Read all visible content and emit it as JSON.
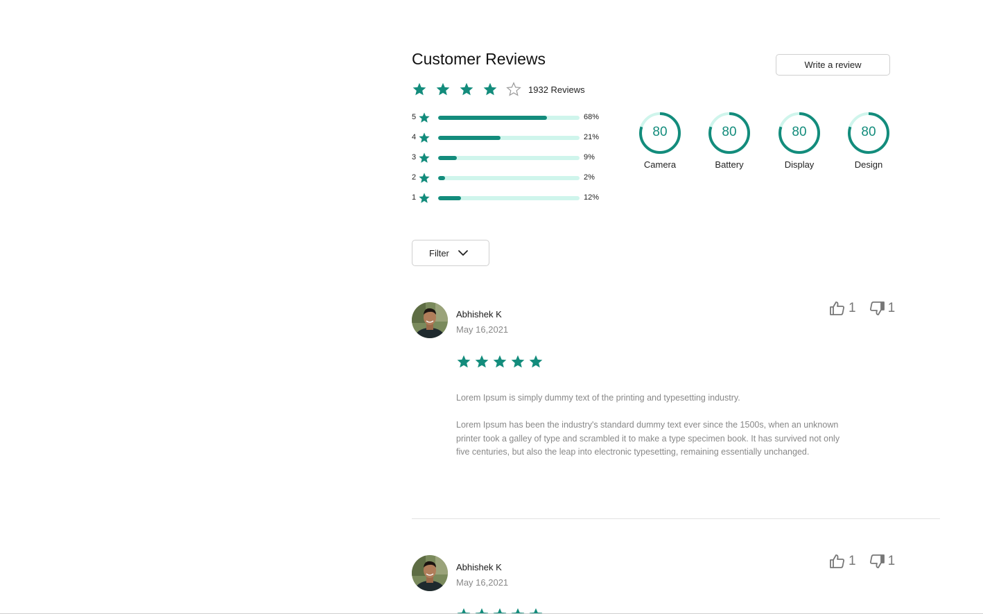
{
  "header": {
    "title": "Customer Reviews",
    "write_review_label": "Write a review"
  },
  "summary": {
    "rating_stars": 4,
    "max_stars": 5,
    "review_count_text": "1932 Reviews"
  },
  "distribution": [
    {
      "stars": "5",
      "percent_label": "68%",
      "fill_fraction": 0.77
    },
    {
      "stars": "4",
      "percent_label": "21%",
      "fill_fraction": 0.44
    },
    {
      "stars": "3",
      "percent_label": "9%",
      "fill_fraction": 0.13
    },
    {
      "stars": "2",
      "percent_label": "2%",
      "fill_fraction": 0.05
    },
    {
      "stars": "1",
      "percent_label": "12%",
      "fill_fraction": 0.16
    }
  ],
  "aspects": [
    {
      "label": "Camera",
      "score": "80",
      "fraction": 0.8
    },
    {
      "label": "Battery",
      "score": "80",
      "fraction": 0.8
    },
    {
      "label": "Display",
      "score": "80",
      "fraction": 0.8
    },
    {
      "label": "Design",
      "score": "80",
      "fraction": 0.8
    }
  ],
  "filter": {
    "label": "Filter"
  },
  "reviews": [
    {
      "name": "Abhishek K",
      "date": "May 16,2021",
      "stars": 5,
      "likes": "1",
      "dislikes": "1",
      "text1": "Lorem Ipsum is simply dummy text of the printing and typesetting industry.",
      "text2": "Lorem Ipsum has been the industry's standard dummy text ever since the 1500s, when an unknown printer took a galley of type and scrambled it to make a type specimen book. It has survived not only five centuries, but also the leap into electronic typesetting, remaining essentially unchanged."
    },
    {
      "name": "Abhishek K",
      "date": "May 16,2021",
      "stars": 5,
      "likes": "1",
      "dislikes": "1"
    }
  ],
  "colors": {
    "accent": "#138c7c",
    "track": "#cff5ec",
    "muted_text": "#888888"
  },
  "icons": {
    "star": "star-icon",
    "star_outline": "star-outline-icon",
    "like": "thumbs-up-icon",
    "dislike": "thumbs-down-icon",
    "chevron": "chevron-down-icon"
  }
}
